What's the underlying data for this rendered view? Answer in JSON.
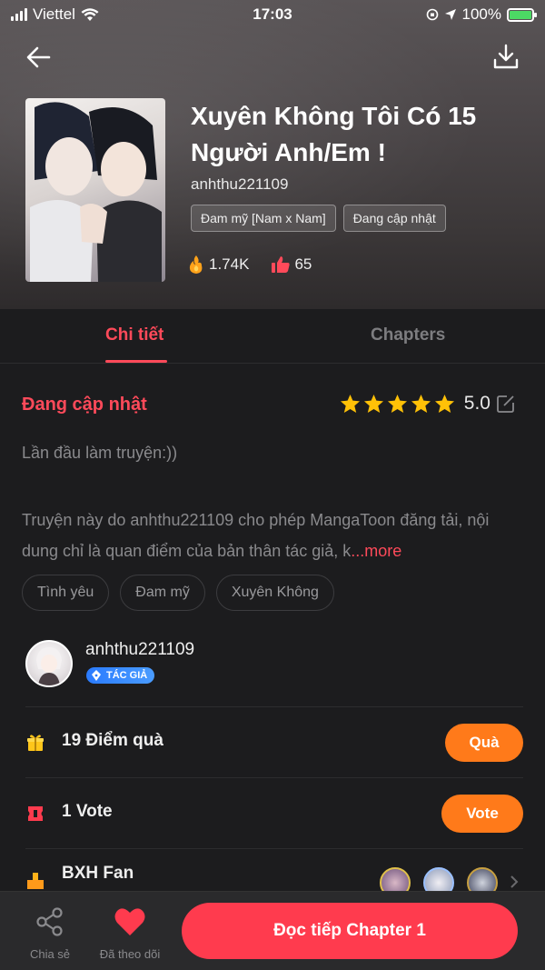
{
  "status_bar": {
    "carrier": "Viettel",
    "time": "17:03",
    "battery": "100%"
  },
  "book": {
    "title": "Xuyên Không Tôi Có 15 Người Anh/Em !",
    "author": "anhthu221109",
    "tags": [
      "Đam mỹ [Nam x Nam]",
      "Đang cập nhật"
    ],
    "views": "1.74K",
    "likes": "65"
  },
  "tabs": {
    "details": "Chi tiết",
    "chapters": "Chapters"
  },
  "details": {
    "status": "Đang cập nhật",
    "rating": "5.0",
    "stars": 5,
    "intro": "Lần đầu làm truyện:))",
    "disclaimer": "Truyện này do anhthu221109 cho phép MangaToon đăng tải, nội dung chỉ là quan điểm của bản thân tác giả, k",
    "more": "...more",
    "genres": [
      "Tình yêu",
      "Đam mỹ",
      "Xuyên Không"
    ]
  },
  "author_card": {
    "name": "anhthu221109",
    "badge": "TÁC GIẢ"
  },
  "gift": {
    "label": "19 Điểm quà",
    "button": "Quà"
  },
  "vote": {
    "label": "1 Vote",
    "button": "Vote"
  },
  "fan": {
    "label": "BXH Fan"
  },
  "bottom": {
    "share": "Chia sẻ",
    "follow": "Đã theo dõi",
    "read": "Đọc tiếp Chapter 1"
  },
  "colors": {
    "accent": "#ff4a5a",
    "orange": "#ff7a1a",
    "background": "#1c1c1e"
  }
}
